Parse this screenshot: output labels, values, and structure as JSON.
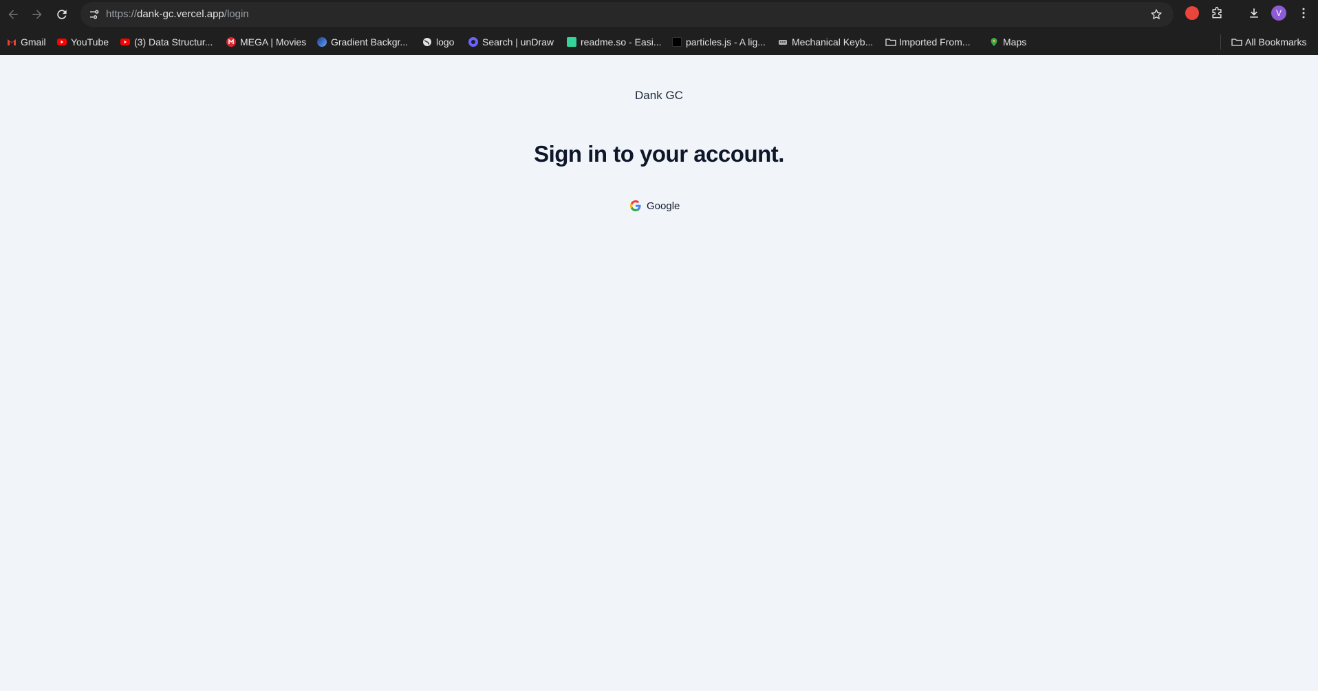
{
  "browser": {
    "url_scheme": "https://",
    "url_host": "dank-gc.vercel.app",
    "url_path": "/login",
    "avatar_letter": "V",
    "bookmarks": [
      {
        "label": "Gmail",
        "icon": "gmail-icon",
        "color": "#ea4335"
      },
      {
        "label": "YouTube",
        "icon": "youtube-icon",
        "color": "#ff0000"
      },
      {
        "label": "(3) Data Structur...",
        "icon": "youtube-icon",
        "color": "#ff0000"
      },
      {
        "label": "MEGA | Movies",
        "icon": "mega-icon",
        "color": "#d9272e"
      },
      {
        "label": "Gradient Backgr...",
        "icon": "gradient-icon",
        "color": "#2563eb"
      },
      {
        "label": "logo",
        "icon": "globe-icon",
        "color": "#e3e3e3"
      },
      {
        "label": "Search | unDraw",
        "icon": "undraw-icon",
        "color": "#6c63ff"
      },
      {
        "label": "readme.so - Easi...",
        "icon": "readme-icon",
        "color": "#34d399"
      },
      {
        "label": "particles.js - A lig...",
        "icon": "particles-icon",
        "color": "#000000"
      },
      {
        "label": "Mechanical Keyb...",
        "icon": "keyboard-icon",
        "color": "#c0c0c0"
      },
      {
        "label": "Imported From...",
        "icon": "folder-icon",
        "color": "#e3e3e3"
      },
      {
        "label": "Maps",
        "icon": "maps-icon",
        "color": "#34a853"
      }
    ],
    "all_bookmarks": "All Bookmarks"
  },
  "page": {
    "brand": "Dank GC",
    "heading": "Sign in to your account.",
    "google_button": "Google"
  }
}
